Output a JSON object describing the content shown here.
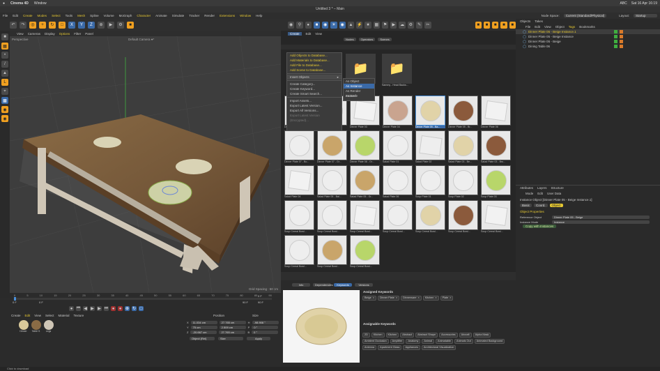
{
  "mac": {
    "apple": "",
    "app": "Cinema 4D",
    "menu": "Window",
    "clock": "Sat 16 Apr 16:19",
    "status_icons": "ABC"
  },
  "window_title": "Untitled 3 * – Main",
  "menubar": {
    "items": [
      "File",
      "Edit",
      "Create",
      "Modes",
      "Select",
      "Tools",
      "Mesh",
      "Spline",
      "Volume",
      "MoGraph",
      "Character",
      "Animate",
      "Simulate",
      "Tracker",
      "Render",
      "Extensions",
      "Window",
      "Help"
    ],
    "highlight": [
      "Create",
      "Modes",
      "Select",
      "Mesh",
      "Character",
      "Extensions",
      "Window"
    ],
    "node_space_label": "Node Space:",
    "node_space_value": "Current (Standard/Physical)",
    "layout_label": "Layout:",
    "layout_value": "Startup"
  },
  "viewport": {
    "menu": [
      "View",
      "Cameras",
      "Display",
      "Options",
      "Filter",
      "Panel"
    ],
    "menu_highlight": "Options",
    "projection": "Perspective",
    "camera": "Default Camera ●*",
    "grid_spacing": "Grid Spacing : 50 cm"
  },
  "timeline": {
    "ticks": [
      "0",
      "5",
      "10",
      "15",
      "20",
      "25",
      "30",
      "35",
      "40",
      "45",
      "50",
      "55",
      "60",
      "65",
      "70",
      "75",
      "80",
      "85",
      "90"
    ],
    "start": "0 F",
    "current": "0 F",
    "end": "90 F",
    "end2": "90 F",
    "frame_right": "0 F"
  },
  "materials": {
    "menu": [
      "Create",
      "Edit",
      "View",
      "Select",
      "Material",
      "Texture"
    ],
    "menu_highlight": "Edit",
    "items": [
      "Dinner",
      "Table S",
      "Legs"
    ]
  },
  "coords": {
    "headers": [
      "Position",
      "Size",
      "Rotation"
    ],
    "rows": [
      {
        "axis": "X",
        "pos": "11.034 cm",
        "size": "27.765 cm",
        "raxis": "H",
        "rot": "-98.908 °"
      },
      {
        "axis": "Y",
        "pos": "75 cm",
        "size": "2.509 cm",
        "raxis": "P",
        "rot": "0 °"
      },
      {
        "axis": "Z",
        "pos": "-20.667 cm",
        "size": "27.765 cm",
        "raxis": "B",
        "rot": "0 °"
      }
    ],
    "mode1": "Object (Rel)",
    "mode2": "Size",
    "apply": "Apply"
  },
  "asset_browser": {
    "tabs": [
      "Create",
      "Edit",
      "View"
    ],
    "tab_active": "Create",
    "sub_tabs": [
      "Nodes",
      "Operators",
      "Scenes"
    ],
    "context_menu": [
      {
        "label": "Add Objects to Database...",
        "style": "y"
      },
      {
        "label": "Add Materials to Database...",
        "style": "y"
      },
      {
        "label": "Add File to Database...",
        "style": "y"
      },
      {
        "label": "Add Scene to Database...",
        "style": "y"
      },
      {
        "label": "",
        "style": "sep"
      },
      {
        "label": "Insert Objects",
        "style": "hover"
      },
      {
        "label": "",
        "style": "sep"
      },
      {
        "label": "Create Category...",
        "style": ""
      },
      {
        "label": "Create Keyword...",
        "style": ""
      },
      {
        "label": "Create Smart Search...",
        "style": ""
      },
      {
        "label": "",
        "style": "sep"
      },
      {
        "label": "Import Assets...",
        "style": ""
      },
      {
        "label": "Export Latest Version...",
        "style": ""
      },
      {
        "label": "Export All Versions...",
        "style": ""
      },
      {
        "label": "Export Latest Version (Encrypted)...",
        "style": "dim"
      }
    ],
    "submenu": [
      "As Object",
      "As Instance",
      "As Render Instance",
      "As Xref"
    ],
    "submenu_active": "As Instance",
    "folders": [
      "Fusion Head Backup...",
      "Sammy - Head Backs..."
    ],
    "tiles": [
      {
        "cap": "Dinner Plate 01",
        "c": "#eeeeee",
        "s": "plate"
      },
      {
        "cap": "Dinner Plate 02",
        "c": "#eeeeee",
        "s": "plate"
      },
      {
        "cap": "Dinner Plate 03",
        "c": "#f2f2f2",
        "s": "sq"
      },
      {
        "cap": "Dinner Plate 04",
        "c": "#c9a48f",
        "s": "plate"
      },
      {
        "cap": "Dinner Plate 05 - Ba...",
        "c": "#e1d3a8",
        "s": "plate",
        "sel": true
      },
      {
        "cap": "Dinner Plate 05 - Br...",
        "c": "#8b5a3c",
        "s": "plate"
      },
      {
        "cap": "Dinner Plate 06",
        "c": "#f2f2f2",
        "s": "sq"
      },
      {
        "cap": "Dinner Plate 07 - Bo...",
        "c": "#eeeeee",
        "s": "plate"
      },
      {
        "cap": "Dinner Plate 07 - Gr...",
        "c": "#c9a56a",
        "s": "plate"
      },
      {
        "cap": "Dinner Plate 08 - Gr...",
        "c": "#b8d66a",
        "s": "plate"
      },
      {
        "cap": "Salad Plate 01",
        "c": "#eeeeee",
        "s": "plate"
      },
      {
        "cap": "Salad Plate 02",
        "c": "#eeeeee",
        "s": "sq"
      },
      {
        "cap": "Salad Plate 03 - Be...",
        "c": "#e1d3a8",
        "s": "plate"
      },
      {
        "cap": "Salad Plate 03 - Bro...",
        "c": "#8b5a3c",
        "s": "plate"
      },
      {
        "cap": "Salad Plate 04",
        "c": "#f2f2f2",
        "s": "sq"
      },
      {
        "cap": "Salad Plate 05 - Bal...",
        "c": "#eeeeee",
        "s": "plate"
      },
      {
        "cap": "Salad Plate 05 - Gr...",
        "c": "#c9a56a",
        "s": "plate"
      },
      {
        "cap": "Salad Plate 06",
        "c": "#eeeeee",
        "s": "plate"
      },
      {
        "cap": "Soup Plate 01",
        "c": "#eeeeee",
        "s": "plate"
      },
      {
        "cap": "Soup Plate 02",
        "c": "#eeeeee",
        "s": "plate"
      },
      {
        "cap": "Soup Plate 03",
        "c": "#b8d66a",
        "s": "plate"
      },
      {
        "cap": "Soup Cereal Bowl...",
        "c": "#eeeeee",
        "s": "plate"
      },
      {
        "cap": "Soup Cereal Bowl...",
        "c": "#eeeeee",
        "s": "plate"
      },
      {
        "cap": "Soup Cereal Bowl...",
        "c": "#f2f2f2",
        "s": "sq"
      },
      {
        "cap": "Soup Cereal Bowl...",
        "c": "#eeeeee",
        "s": "plate"
      },
      {
        "cap": "Soup Cereal Bowl...",
        "c": "#e1d3a8",
        "s": "plate"
      },
      {
        "cap": "Soup Cereal Bowl...",
        "c": "#8b5a3c",
        "s": "plate"
      },
      {
        "cap": "Soup Cereal Bowl...",
        "c": "#f2f2f2",
        "s": "sq"
      },
      {
        "cap": "Soup Cereal Bowl...",
        "c": "#eeeeee",
        "s": "plate"
      },
      {
        "cap": "Soup Cereal Bowl...",
        "c": "#c9a56a",
        "s": "plate"
      },
      {
        "cap": "Soup Cereal Bowl...",
        "c": "#b8d66a",
        "s": "plate"
      }
    ],
    "info_tabs": [
      "Info",
      "Dependencies",
      "Keywords",
      "Versions"
    ],
    "info_tab_active": "Keywords",
    "assigned_title": "Assigned Keywords",
    "assigned": [
      "Beige",
      "Dinner Plate",
      "Dinnerware",
      "Kitchen",
      "Plate"
    ],
    "assignable_title": "Assignable Keywords",
    "assignable": [
      "2D",
      "Kitchen",
      "Kitchen",
      "Abstract",
      "Abstract Shape",
      "Accessories",
      "Aircraft",
      "Alpha Mask",
      "Ambient Occlusion",
      "Amplifier",
      "Anatomy",
      "Animal",
      "Animatable",
      "Animals Out",
      "Animated Background",
      "Antenna",
      "Apartment Glass",
      "Appliances",
      "Architectural Visualization"
    ]
  },
  "objects": {
    "tabs": [
      "Objects",
      "Takes"
    ],
    "menu": [
      "File",
      "Edit",
      "View",
      "Object",
      "Tags",
      "Bookmarks"
    ],
    "rows": [
      {
        "name": "Dinner Plate 05 - Beige Instance.1",
        "sel": true
      },
      {
        "name": "Dinner Plate 05 - Beige Instance",
        "sel": false
      },
      {
        "name": "Dinner Plate 05 - Beige",
        "sel": false
      },
      {
        "name": "Dining Table 06",
        "sel": false
      }
    ]
  },
  "attributes": {
    "tabs": [
      "Attributes",
      "Layers",
      "Structure"
    ],
    "menu": [
      "Mode",
      "Edit",
      "User Data"
    ],
    "title": "Instance Object [Dinner Plate 05 - Beige Instance.1]",
    "sub_tabs": [
      "Basic",
      "Coord.",
      "Object"
    ],
    "sub_active": "Object",
    "section": "Object Properties",
    "props": [
      {
        "label": "Reference Object",
        "value": "Dinner Plate 05 - Beige"
      },
      {
        "label": "Instance Mode",
        "value": "Instance"
      }
    ],
    "button": "Copy with Instances"
  },
  "status": "Click to download"
}
